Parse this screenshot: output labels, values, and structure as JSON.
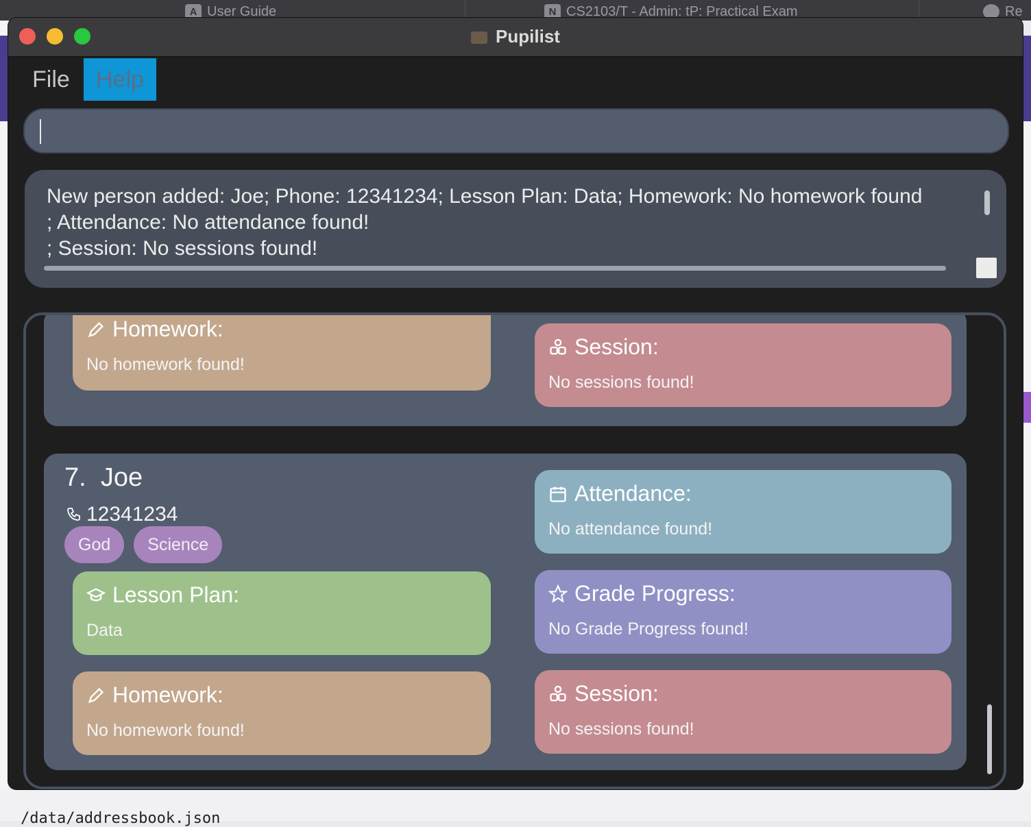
{
  "background": {
    "tabs": [
      {
        "icon": "A",
        "label": "User Guide"
      },
      {
        "icon": "N",
        "label": "CS2103/T - Admin: tP: Practical Exam"
      },
      {
        "icon": "",
        "label": "Re"
      }
    ],
    "bottom_text": "/data/addressbook.json"
  },
  "window": {
    "title": "Pupilist",
    "menu": [
      "File",
      "Help"
    ]
  },
  "command_box": {
    "value": "",
    "placeholder": ""
  },
  "result": {
    "text": "New person added: Joe; Phone: 12341234; Lesson Plan: Data; Homework: No homework found\n; Attendance: No attendance found!\n; Session: No sessions found!"
  },
  "previous_card": {
    "homework": {
      "label": "Homework:",
      "value": "No homework found!"
    },
    "session": {
      "label": "Session:",
      "value": "No sessions found!"
    }
  },
  "student": {
    "index": "7.",
    "name": "Joe",
    "phone": "12341234",
    "tags": [
      "God",
      "Science"
    ],
    "lesson_plan": {
      "label": "Lesson Plan:",
      "value": "Data"
    },
    "homework": {
      "label": "Homework:",
      "value": "No homework found!"
    },
    "attendance": {
      "label": "Attendance:",
      "value": "No attendance found!"
    },
    "grade_progress": {
      "label": "Grade Progress:",
      "value": "No Grade Progress found!"
    },
    "session": {
      "label": "Session:",
      "value": "No sessions found!"
    }
  },
  "colors": {
    "homework": "#c3a78d",
    "session": "#c48b91",
    "attendance": "#8db0c1",
    "grade_progress": "#9190c5",
    "lesson_plan": "#9ec18c",
    "tag": "#a884bd",
    "help_highlight": "#0e96d6"
  }
}
